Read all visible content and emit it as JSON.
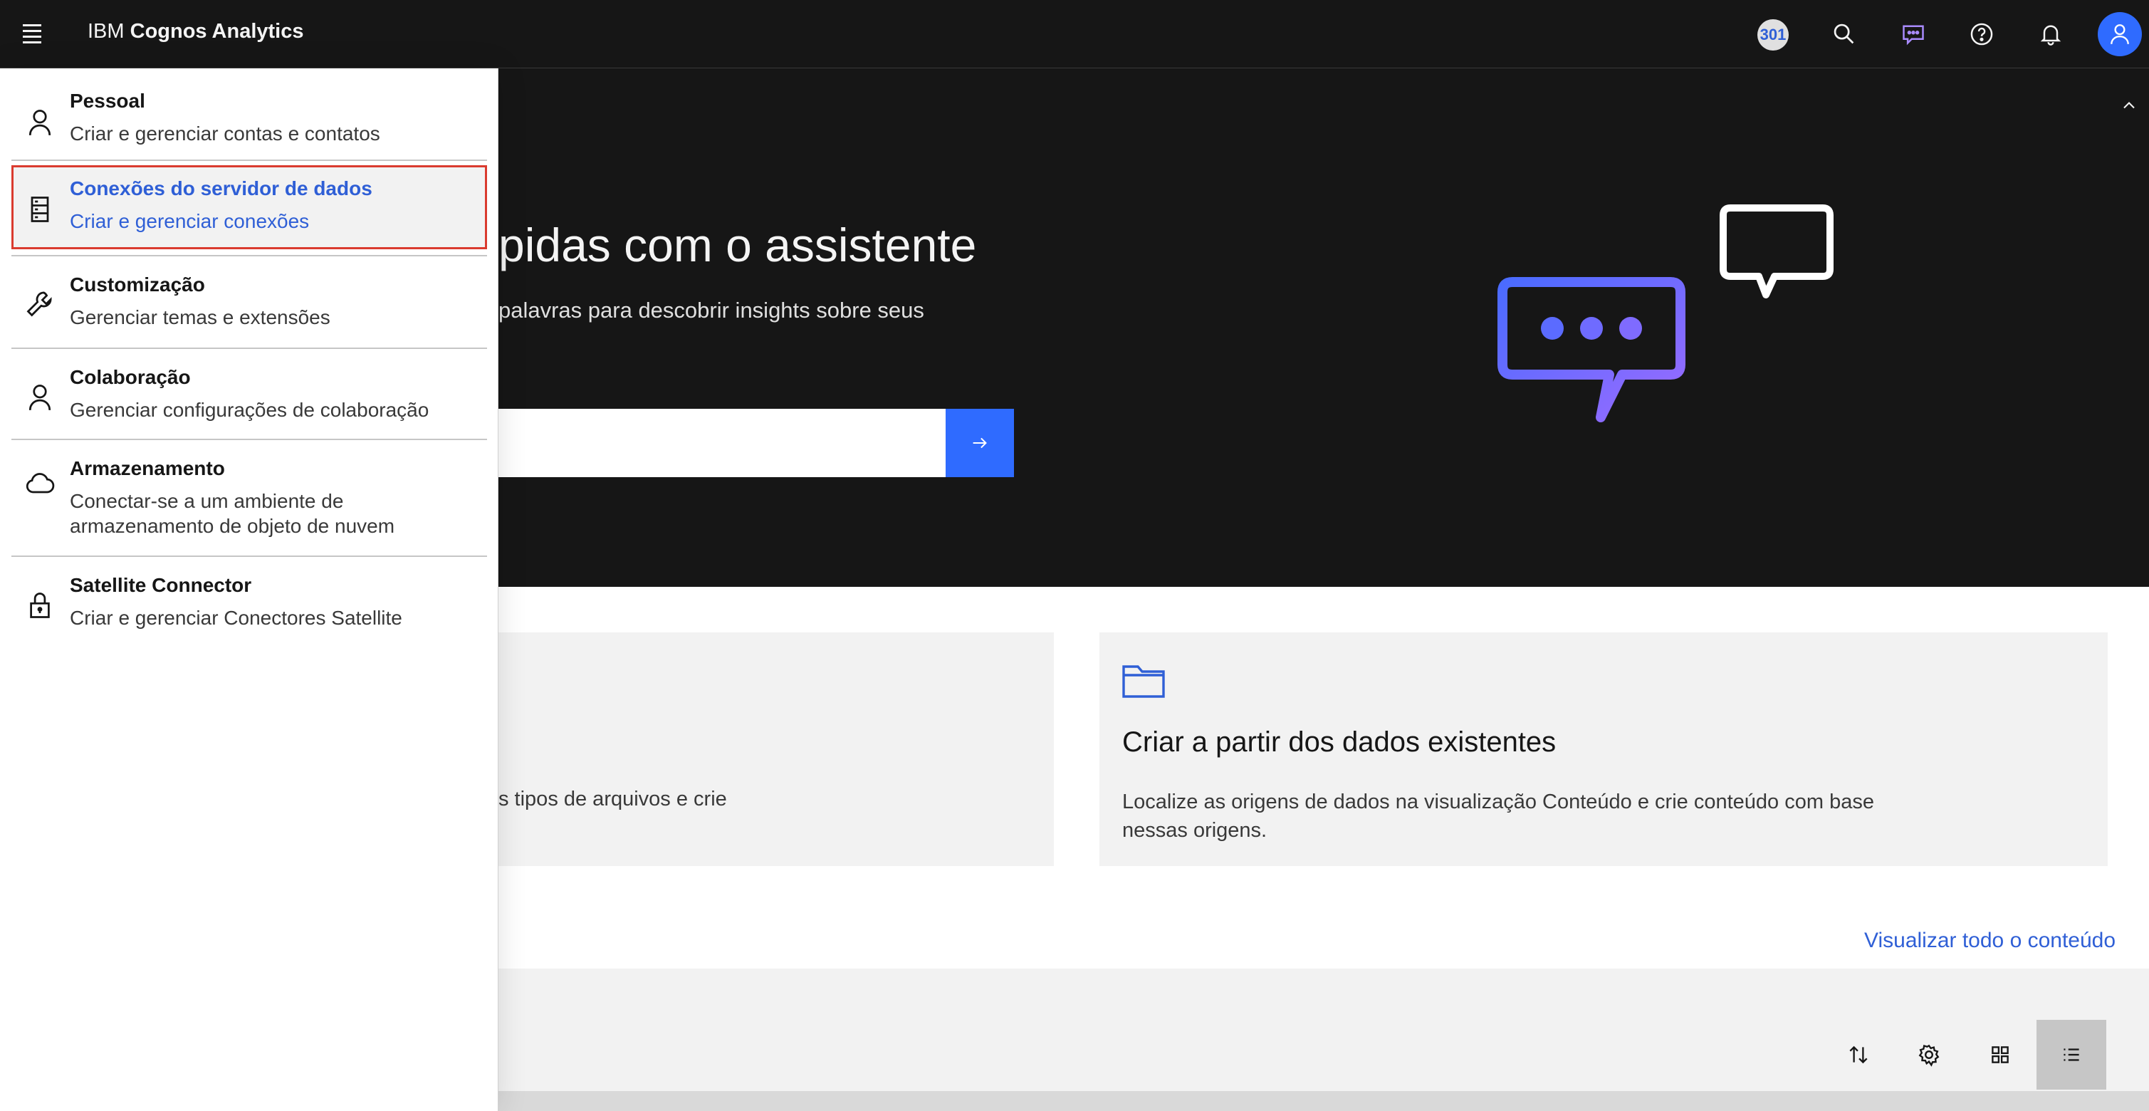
{
  "header": {
    "brand_prefix": "IBM",
    "brand_name": "Cognos Analytics",
    "count_badge": "301",
    "icons": [
      "menu-icon",
      "search-icon",
      "assistant-chat-icon",
      "help-icon",
      "notification-bell-icon",
      "user-avatar-icon"
    ]
  },
  "hero": {
    "title": "pidas com o assistente",
    "subtitle": "palavras para descobrir insights sobre seus",
    "input_value": "",
    "submit_icon": "arrow-right-icon",
    "collapse_icon": "chevron-up-icon"
  },
  "cards": {
    "left_desc": "s tipos de arquivos e crie",
    "right_title": "Criar a partir dos dados existentes",
    "right_desc": "Localize as origens de dados na visualização Conteúdo e crie conteúdo com base nessas origens.",
    "right_icon": "folder-icon"
  },
  "view_all": "Visualizar todo o conteúdo",
  "toolbar": {
    "buttons": [
      "sort-icon",
      "settings-gear-icon",
      "grid-view-icon",
      "list-view-icon"
    ],
    "active": "list-view-icon"
  },
  "panel": {
    "items": [
      {
        "title": "Pessoal",
        "desc": "Criar e gerenciar contas e contatos",
        "icon": "person-icon"
      },
      {
        "title": "Conexões do servidor de dados",
        "desc": "Criar e gerenciar conexões",
        "icon": "data-server-icon"
      },
      {
        "title": "Customização",
        "desc": "Gerenciar temas e extensões",
        "icon": "wrench-icon"
      },
      {
        "title": "Colaboração",
        "desc": "Gerenciar configurações de colaboração",
        "icon": "person-icon"
      },
      {
        "title": "Armazenamento",
        "desc": "Conectar-se a um ambiente de armazenamento de objeto de nuvem",
        "icon": "cloud-icon"
      },
      {
        "title": "Satellite Connector",
        "desc": "Criar e gerenciar Conectores Satellite",
        "icon": "lock-icon"
      }
    ],
    "selected_index": 1
  },
  "colors": {
    "topbar": "#161616",
    "accent": "#2f6bff",
    "link": "#2f5fd6",
    "highlight_border": "#da3b2f",
    "illustration_gradient": [
      "#4a6bff",
      "#9b6bff"
    ]
  }
}
